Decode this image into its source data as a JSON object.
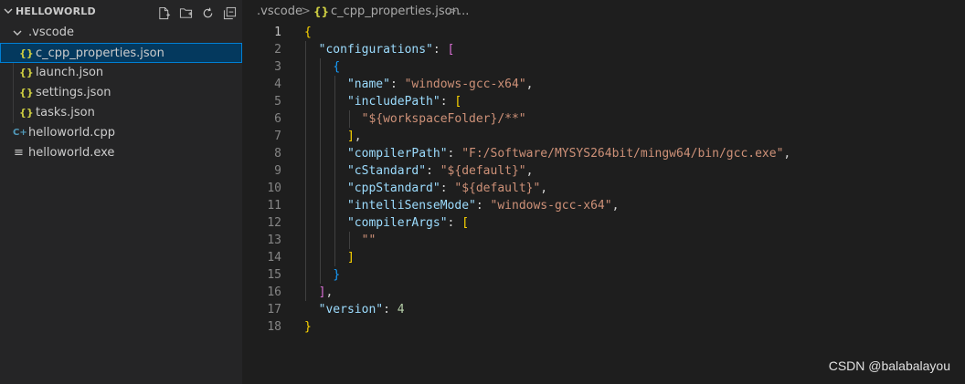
{
  "sidebar": {
    "folder_title": "HELLOWORLD",
    "actions": [
      {
        "name": "new-file-icon"
      },
      {
        "name": "new-folder-icon"
      },
      {
        "name": "refresh-icon"
      },
      {
        "name": "collapse-all-icon"
      }
    ],
    "tree": {
      "vscode_folder": ".vscode",
      "json_icon": "{}",
      "cpp_icon": "C+",
      "exe_icon": "≡",
      "items": [
        {
          "label": "c_cpp_properties.json",
          "selected": true
        },
        {
          "label": "launch.json"
        },
        {
          "label": "settings.json"
        },
        {
          "label": "tasks.json"
        }
      ],
      "cpp_file": "helloworld.cpp",
      "exe_file": "helloworld.exe"
    }
  },
  "breadcrumb": {
    "folder": ".vscode",
    "sep": ">",
    "json_icon": "{}",
    "file": "c_cpp_properties.json",
    "more": "..."
  },
  "editor": {
    "line_numbers": [
      "1",
      "2",
      "3",
      "4",
      "5",
      "6",
      "7",
      "8",
      "9",
      "10",
      "11",
      "12",
      "13",
      "14",
      "15",
      "16",
      "17",
      "18"
    ],
    "active_line": 1,
    "lines": [
      {
        "indent": "",
        "tokens": [
          {
            "t": "brace1",
            "v": "{"
          }
        ]
      },
      {
        "indent": "  ",
        "tokens": [
          {
            "t": "key",
            "v": "\"configurations\""
          },
          {
            "t": "punc",
            "v": ": "
          },
          {
            "t": "brace2",
            "v": "["
          }
        ]
      },
      {
        "indent": "    ",
        "tokens": [
          {
            "t": "brace3",
            "v": "{"
          }
        ]
      },
      {
        "indent": "      ",
        "tokens": [
          {
            "t": "key",
            "v": "\"name\""
          },
          {
            "t": "punc",
            "v": ": "
          },
          {
            "t": "str",
            "v": "\"windows-gcc-x64\""
          },
          {
            "t": "punc",
            "v": ","
          }
        ]
      },
      {
        "indent": "      ",
        "tokens": [
          {
            "t": "key",
            "v": "\"includePath\""
          },
          {
            "t": "punc",
            "v": ": "
          },
          {
            "t": "brace1",
            "v": "["
          }
        ]
      },
      {
        "indent": "        ",
        "tokens": [
          {
            "t": "str",
            "v": "\"${workspaceFolder}/**\""
          }
        ]
      },
      {
        "indent": "      ",
        "tokens": [
          {
            "t": "brace1",
            "v": "]"
          },
          {
            "t": "punc",
            "v": ","
          }
        ]
      },
      {
        "indent": "      ",
        "tokens": [
          {
            "t": "key",
            "v": "\"compilerPath\""
          },
          {
            "t": "punc",
            "v": ": "
          },
          {
            "t": "str",
            "v": "\"F:/Software/MYSYS264bit/mingw64/bin/gcc.exe\""
          },
          {
            "t": "punc",
            "v": ","
          }
        ]
      },
      {
        "indent": "      ",
        "tokens": [
          {
            "t": "key",
            "v": "\"cStandard\""
          },
          {
            "t": "punc",
            "v": ": "
          },
          {
            "t": "str",
            "v": "\"${default}\""
          },
          {
            "t": "punc",
            "v": ","
          }
        ]
      },
      {
        "indent": "      ",
        "tokens": [
          {
            "t": "key",
            "v": "\"cppStandard\""
          },
          {
            "t": "punc",
            "v": ": "
          },
          {
            "t": "str",
            "v": "\"${default}\""
          },
          {
            "t": "punc",
            "v": ","
          }
        ]
      },
      {
        "indent": "      ",
        "tokens": [
          {
            "t": "key",
            "v": "\"intelliSenseMode\""
          },
          {
            "t": "punc",
            "v": ": "
          },
          {
            "t": "str",
            "v": "\"windows-gcc-x64\""
          },
          {
            "t": "punc",
            "v": ","
          }
        ]
      },
      {
        "indent": "      ",
        "tokens": [
          {
            "t": "key",
            "v": "\"compilerArgs\""
          },
          {
            "t": "punc",
            "v": ": "
          },
          {
            "t": "brace1",
            "v": "["
          }
        ]
      },
      {
        "indent": "        ",
        "tokens": [
          {
            "t": "str",
            "v": "\"\""
          }
        ]
      },
      {
        "indent": "      ",
        "tokens": [
          {
            "t": "brace1",
            "v": "]"
          }
        ]
      },
      {
        "indent": "    ",
        "tokens": [
          {
            "t": "brace3",
            "v": "}"
          }
        ]
      },
      {
        "indent": "  ",
        "tokens": [
          {
            "t": "brace2",
            "v": "]"
          },
          {
            "t": "punc",
            "v": ","
          }
        ]
      },
      {
        "indent": "  ",
        "tokens": [
          {
            "t": "key",
            "v": "\"version\""
          },
          {
            "t": "punc",
            "v": ": "
          },
          {
            "t": "num",
            "v": "4"
          }
        ]
      },
      {
        "indent": "",
        "tokens": [
          {
            "t": "brace1",
            "v": "}"
          }
        ]
      }
    ]
  },
  "watermark": "CSDN @balabalayou"
}
